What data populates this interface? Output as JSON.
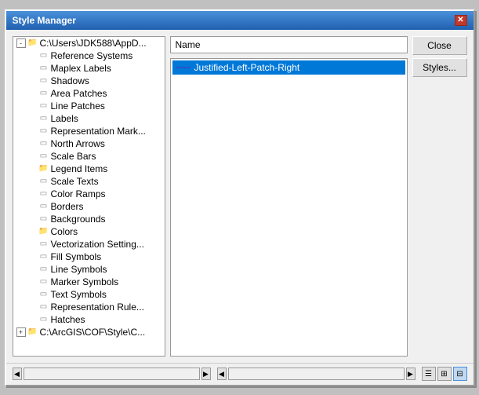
{
  "window": {
    "title": "Style Manager",
    "close_label": "✕"
  },
  "buttons": {
    "close_label": "Close",
    "styles_label": "Styles..."
  },
  "header": {
    "name_label": "Name"
  },
  "tree": {
    "root1": {
      "label": "C:\\Users\\JDK588\\AppD...",
      "expanded": true,
      "items": [
        {
          "label": "Reference Systems",
          "type": "leaf",
          "icon": "dash"
        },
        {
          "label": "Maplex Labels",
          "type": "leaf",
          "icon": "dash"
        },
        {
          "label": "Shadows",
          "type": "leaf",
          "icon": "dash"
        },
        {
          "label": "Area Patches",
          "type": "leaf",
          "icon": "dash"
        },
        {
          "label": "Line Patches",
          "type": "leaf",
          "icon": "dash"
        },
        {
          "label": "Labels",
          "type": "leaf",
          "icon": "dash"
        },
        {
          "label": "Representation Mark...",
          "type": "leaf",
          "icon": "dash"
        },
        {
          "label": "North Arrows",
          "type": "leaf",
          "icon": "dash"
        },
        {
          "label": "Scale Bars",
          "type": "leaf",
          "icon": "dash"
        },
        {
          "label": "Legend Items",
          "type": "folder",
          "icon": "folder"
        },
        {
          "label": "Scale Texts",
          "type": "leaf",
          "icon": "dash"
        },
        {
          "label": "Color Ramps",
          "type": "leaf",
          "icon": "dash"
        },
        {
          "label": "Borders",
          "type": "leaf",
          "icon": "dash"
        },
        {
          "label": "Backgrounds",
          "type": "leaf",
          "icon": "dash"
        },
        {
          "label": "Colors",
          "type": "folder",
          "icon": "folder"
        },
        {
          "label": "Vectorization Setting...",
          "type": "leaf",
          "icon": "dash"
        },
        {
          "label": "Fill Symbols",
          "type": "leaf",
          "icon": "dash"
        },
        {
          "label": "Line Symbols",
          "type": "leaf",
          "icon": "dash"
        },
        {
          "label": "Marker Symbols",
          "type": "leaf",
          "icon": "dash"
        },
        {
          "label": "Text Symbols",
          "type": "leaf",
          "icon": "dash"
        },
        {
          "label": "Representation Rule...",
          "type": "leaf",
          "icon": "dash"
        },
        {
          "label": "Hatches",
          "type": "leaf",
          "icon": "dash"
        }
      ]
    },
    "root2": {
      "label": "C:\\ArcGIS\\COF\\Style\\C...",
      "expanded": false
    }
  },
  "content": {
    "items": [
      {
        "label": "Justified-Left-Patch-Right",
        "selected": true,
        "icon": "line"
      }
    ]
  },
  "view_icons": [
    {
      "name": "list-view-icon",
      "symbol": "☰",
      "active": false
    },
    {
      "name": "detail-view-icon",
      "symbol": "⊞",
      "active": false
    },
    {
      "name": "large-view-icon",
      "symbol": "⊟",
      "active": true
    }
  ]
}
